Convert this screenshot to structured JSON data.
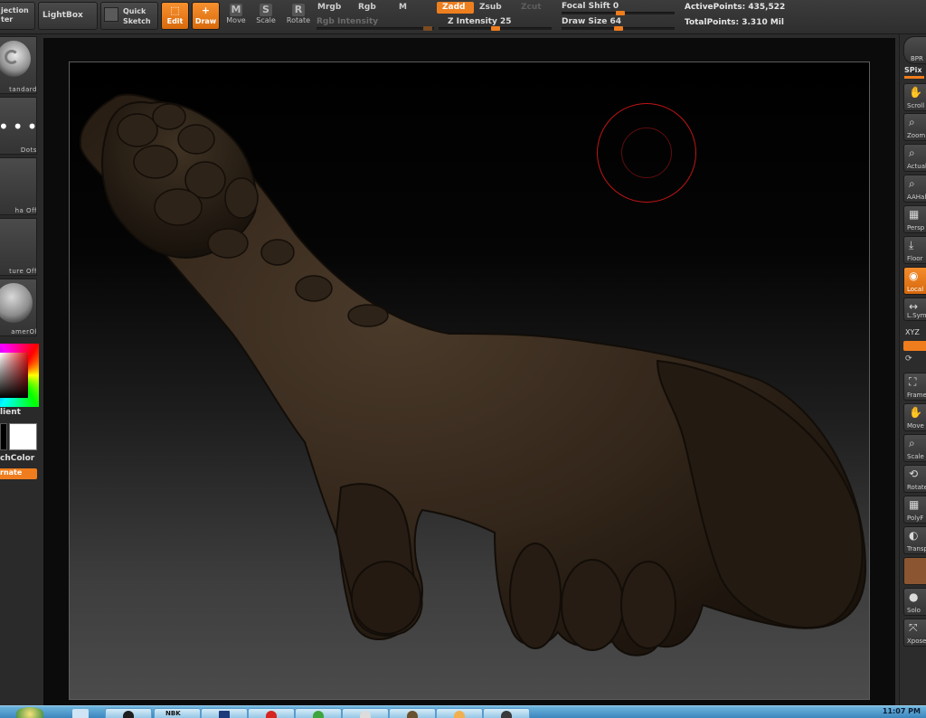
{
  "toolbar": {
    "projection_master_line1": "jection",
    "projection_master_line2": "ter",
    "lightbox_label": "LightBox",
    "quick_sketch_line1": "Quick",
    "quick_sketch_line2": "Sketch",
    "edit_label": "Edit",
    "draw_label": "Draw",
    "move_label": "Move",
    "move_key": "M",
    "scale_label": "Scale",
    "scale_key": "S",
    "rotate_label": "Rotate",
    "rotate_key": "R",
    "mrgb_label": "Mrgb",
    "rgb_label": "Rgb",
    "m_label": "M",
    "rgb_intensity_label": "Rgb Intensity",
    "zadd_label": "Zadd",
    "zsub_label": "Zsub",
    "zcut_label": "Zcut",
    "z_intensity_label": "Z Intensity 25",
    "z_intensity_value": 25,
    "focal_shift_label": "Focal Shift 0",
    "focal_shift_value": 0,
    "draw_size_label": "Draw Size 64",
    "draw_size_value": 64,
    "active_points_label": "ActivePoints: 435,522",
    "total_points_label": "TotalPoints: 3.310 Mil"
  },
  "left_shelf": {
    "brush_label": "tandard",
    "stroke_label": "Dots",
    "alpha_label": "ha Off",
    "texture_label": "ture Off",
    "material_label": "amerOl",
    "gradient_label": "lient",
    "switch_color_label": "chColor",
    "alternate_label": "rnate"
  },
  "right_shelf": {
    "bpr_label": "BPR",
    "spix_label": "SPix",
    "scroll_label": "Scroll",
    "zoom_label": "Zoom",
    "actual_label": "Actual",
    "aahalf_label": "AAHalf",
    "persp_label": "Persp",
    "floor_label": "Floor",
    "local_label": "Local",
    "lsym_label": "L.Sym",
    "xyz_label": "XYZ",
    "frame_label": "Frame",
    "move_label": "Move",
    "scale_label": "Scale",
    "rotate_label": "Rotate",
    "polyf_label": "PolyF",
    "transp_label": "Transp",
    "solo_label": "Solo",
    "xpose_label": "Xpose"
  },
  "taskbar": {
    "clock": "11:07 PM",
    "ie_badge": "NBK"
  },
  "colors": {
    "accent": "#ef7d1d",
    "brush_cursor": "#c01515",
    "main_color": "#000000",
    "secondary_color": "#ffffff"
  }
}
